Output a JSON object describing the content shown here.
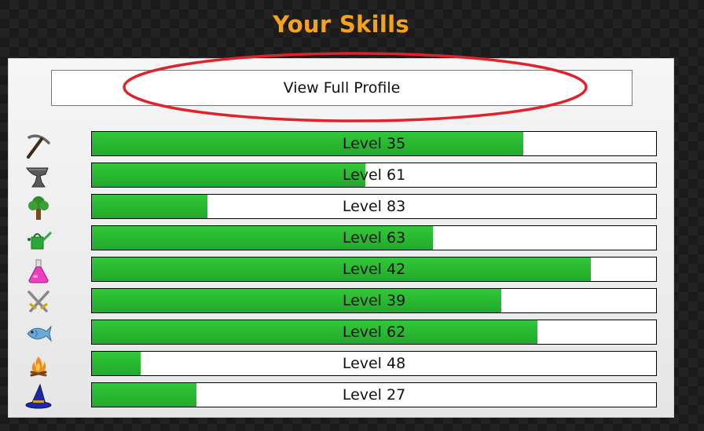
{
  "header": {
    "title": "Your Skills"
  },
  "profile": {
    "button_label": "View Full Profile"
  },
  "colors": {
    "title": "#f7a21b",
    "bar_fill": "#2dbf34",
    "highlight": "#e0232a"
  },
  "skills": [
    {
      "icon": "pickaxe-icon",
      "label": "Level 35",
      "progress": 0.765
    },
    {
      "icon": "anvil-icon",
      "label": "Level 61",
      "progress": 0.485
    },
    {
      "icon": "tree-icon",
      "label": "Level 83",
      "progress": 0.205
    },
    {
      "icon": "watering-can-icon",
      "label": "Level 63",
      "progress": 0.605
    },
    {
      "icon": "potion-flask-icon",
      "label": "Level 42",
      "progress": 0.885
    },
    {
      "icon": "crossed-swords-icon",
      "label": "Level 39",
      "progress": 0.725
    },
    {
      "icon": "fish-icon",
      "label": "Level 62",
      "progress": 0.79
    },
    {
      "icon": "campfire-icon",
      "label": "Level 48",
      "progress": 0.087
    },
    {
      "icon": "wizard-hat-icon",
      "label": "Level 27",
      "progress": 0.185
    }
  ]
}
